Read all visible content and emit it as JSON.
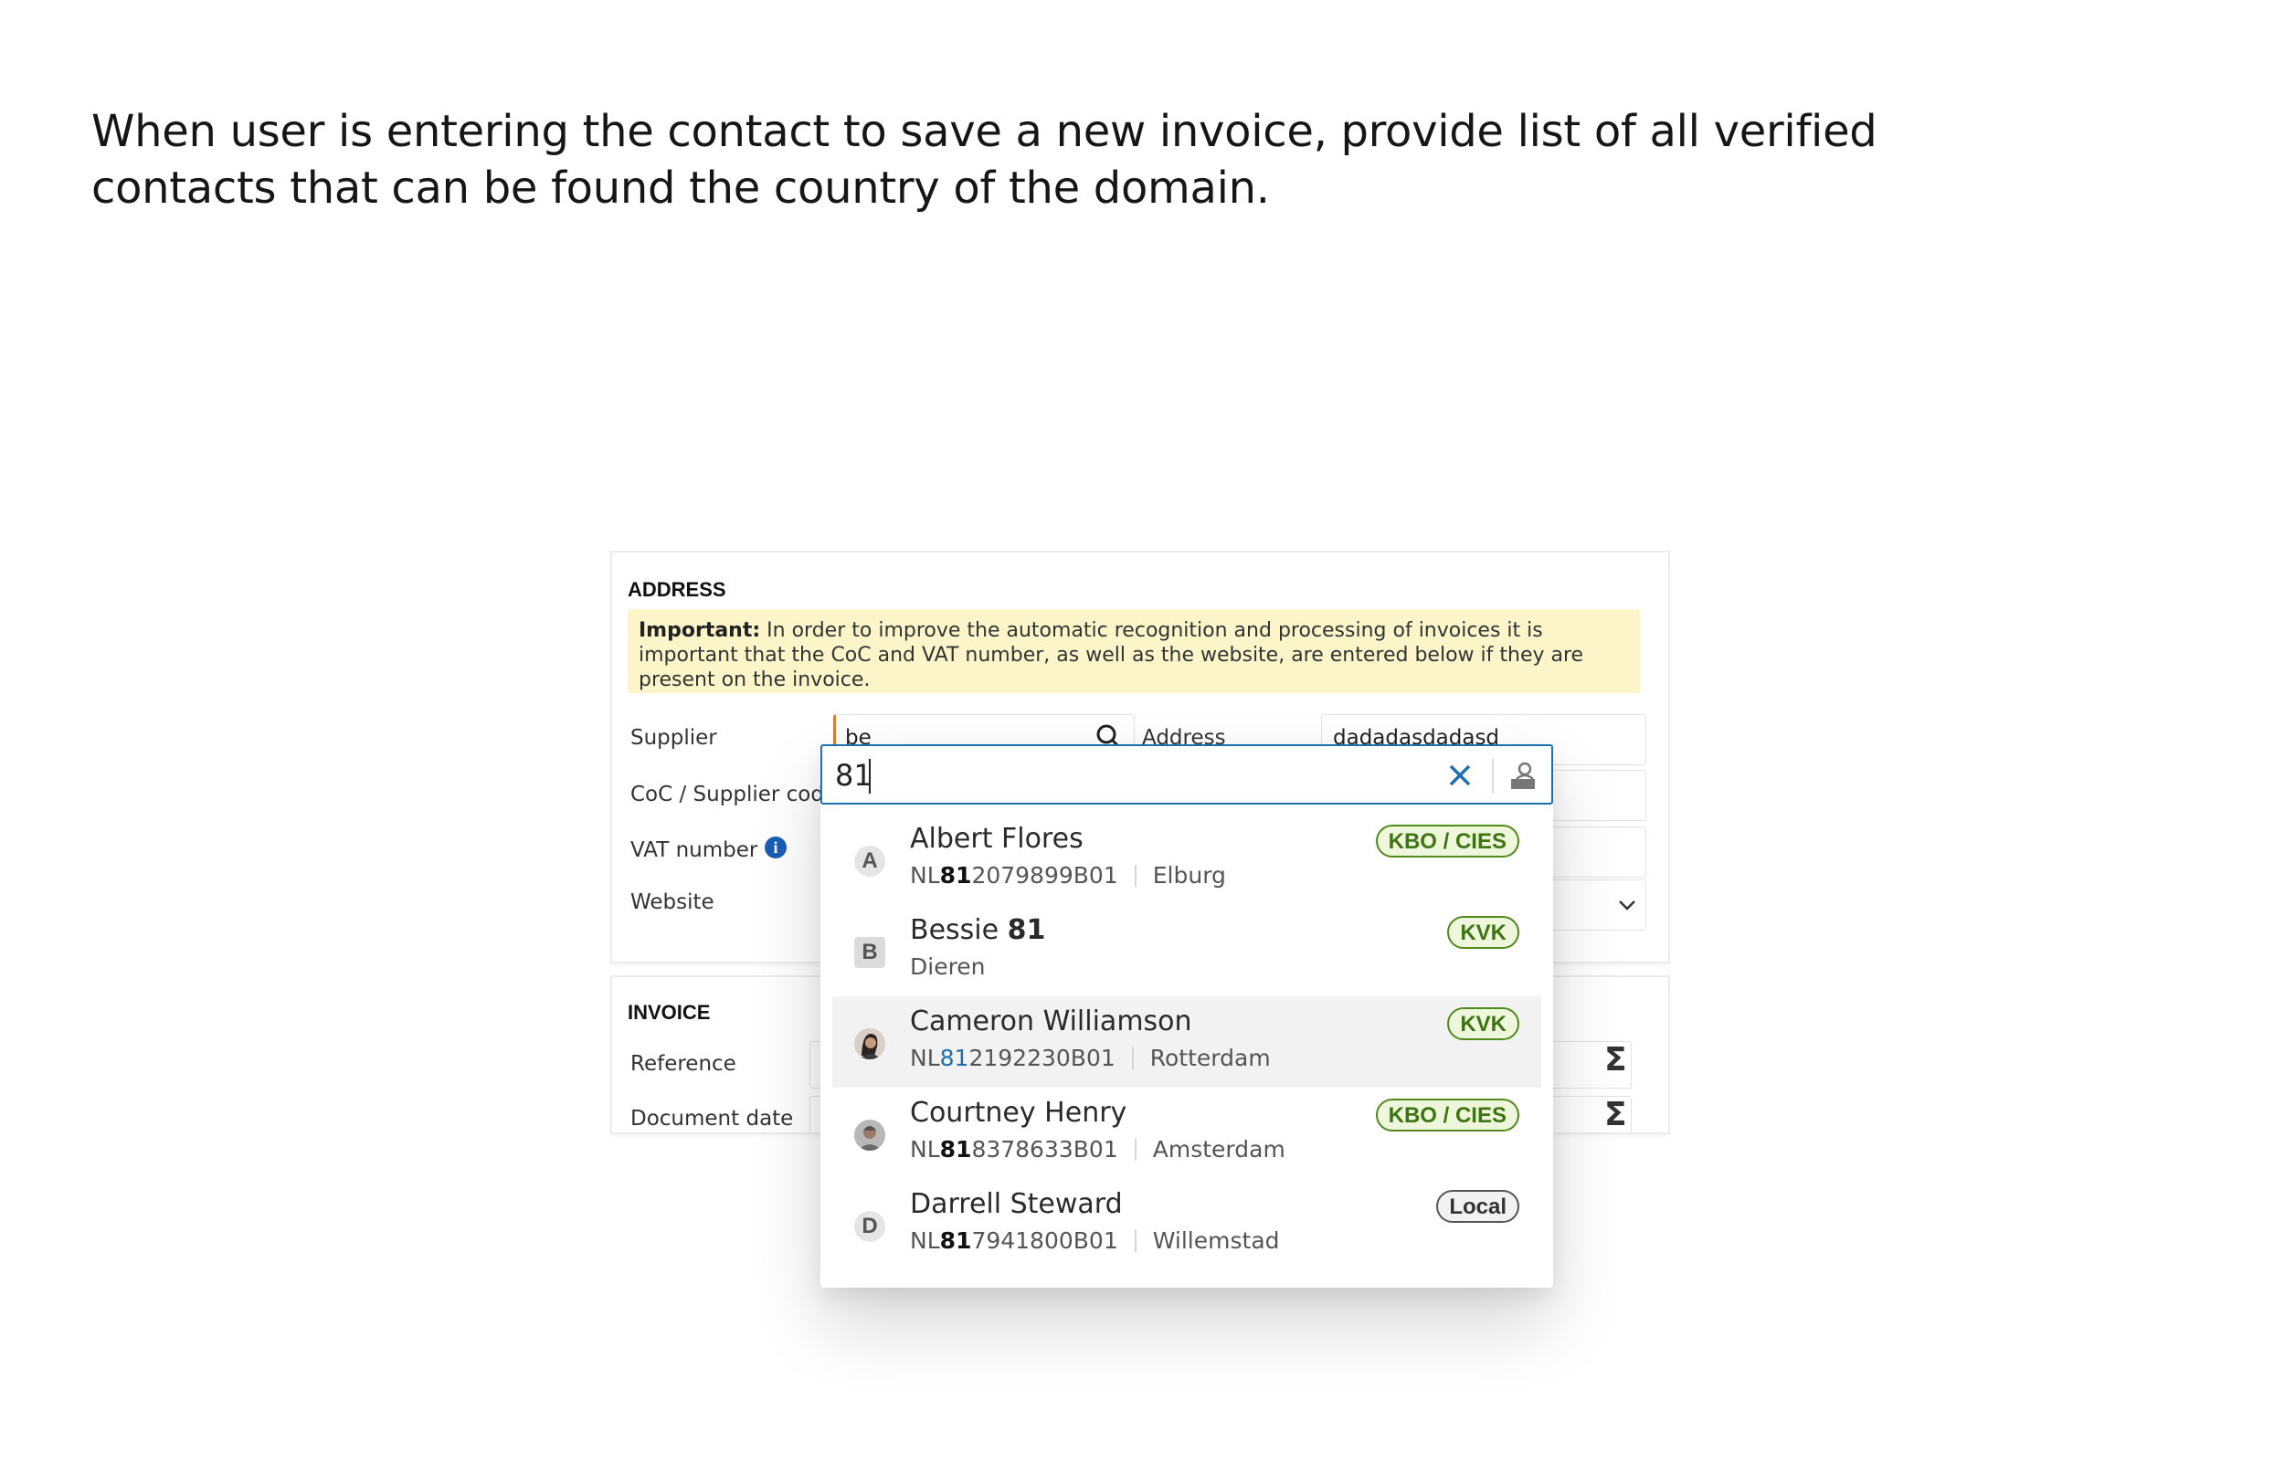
{
  "caption": "When user is entering the contact to save a new invoice, provide list of all verified contacts that can be found the country of the domain.",
  "address_section": {
    "title": "ADDRESS",
    "notice_bold": "Important:",
    "notice_text": " In order to improve the automatic recognition and processing of invoices it is important that the CoC and VAT number, as well as the website, are entered below if they are present on the invoice.",
    "supplier_label": "Supplier",
    "supplier_value": "be",
    "address_label": "Address",
    "address_value": "dadadasdadasd",
    "coc_label": "CoC / Supplier cod",
    "vat_label": "VAT number",
    "website_label": "Website"
  },
  "invoice_section": {
    "title": "INVOICE",
    "reference_label": "Reference",
    "document_date_label": "Document date"
  },
  "dropdown": {
    "search_value": "81",
    "items": [
      {
        "avatar": "A",
        "name": "Albert Flores",
        "name_hi": "",
        "vat_pre": "NL",
        "vat_hi": "81",
        "vat_post": "2079899B01",
        "city": "Elburg",
        "badge": "KBO / CIES",
        "badge_style": "green"
      },
      {
        "avatar": "B",
        "name": "Bessie ",
        "name_hi": "81",
        "vat_pre": "",
        "vat_hi": "",
        "vat_post": "",
        "city": "Dieren",
        "badge": "KVK",
        "badge_style": "green"
      },
      {
        "avatar": "photo",
        "name": "Cameron Williamson",
        "name_hi": "",
        "vat_pre": "NL",
        "vat_hi": "81",
        "vat_post": "2192230B01",
        "city": "Rotterdam",
        "badge": "KVK",
        "badge_style": "green"
      },
      {
        "avatar": "photo",
        "name": "Courtney Henry",
        "name_hi": "",
        "vat_pre": "NL",
        "vat_hi": "81",
        "vat_post": "8378633B01",
        "city": "Amsterdam",
        "badge": "KBO / CIES",
        "badge_style": "green"
      },
      {
        "avatar": "D",
        "name": "Darrell Steward",
        "name_hi": "",
        "vat_pre": "NL",
        "vat_hi": "81",
        "vat_post": "7941800B01",
        "city": "Willemstad",
        "badge": "Local",
        "badge_style": "gray"
      }
    ]
  }
}
